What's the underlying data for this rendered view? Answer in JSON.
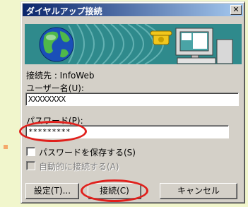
{
  "window": {
    "title": "ダイヤルアップ接続",
    "close_glyph": "✕"
  },
  "banner": {
    "accent_color": "#2f8a8c",
    "icons": [
      "globe-icon",
      "telephone-icon",
      "computer-icon"
    ]
  },
  "form": {
    "connection_label": "接続先 : InfoWeb",
    "username_label": "ユーザー名(U):",
    "username_value": "XXXXXXXX",
    "password_label": "パスワード(P):",
    "password_value": "*********",
    "save_password_label": "パスワードを保存する(S)",
    "auto_connect_label": "自動的に接続する(A)"
  },
  "buttons": {
    "settings": "設定(T)...",
    "connect": "接続(C)",
    "cancel": "キャンセル"
  },
  "annotations": {
    "highlight_color": "#e0201c"
  }
}
